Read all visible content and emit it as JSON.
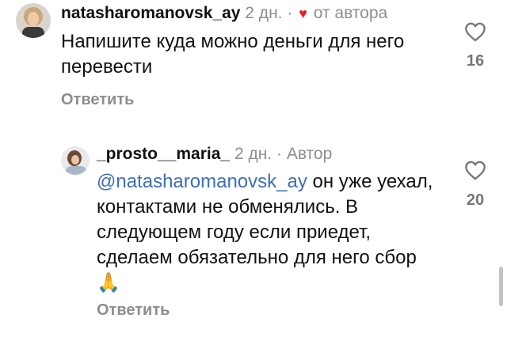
{
  "comments": [
    {
      "username": "natasharomanovsk_ay",
      "time": "2 дн.",
      "separator": "·",
      "heart_icon": "heart-icon",
      "badge": "от автора",
      "text": "Напишите куда можно деньги для него перевести",
      "reply_label": "Ответить",
      "like_count": "16"
    },
    {
      "username": "_prosto__maria_",
      "time": "2 дн.",
      "separator": "·",
      "badge": "Автор",
      "mention": "@natasharomanovsk_ay",
      "text": "он уже уехал, контактами не обменялись. В следующем году если приедет, сделаем обязательно для него сбор",
      "emoji": "🙏",
      "reply_label": "Ответить",
      "like_count": "20"
    }
  ],
  "colors": {
    "mention": "#3f6fb6",
    "heart": "#ed1c24",
    "meta": "#8e8e8e"
  }
}
